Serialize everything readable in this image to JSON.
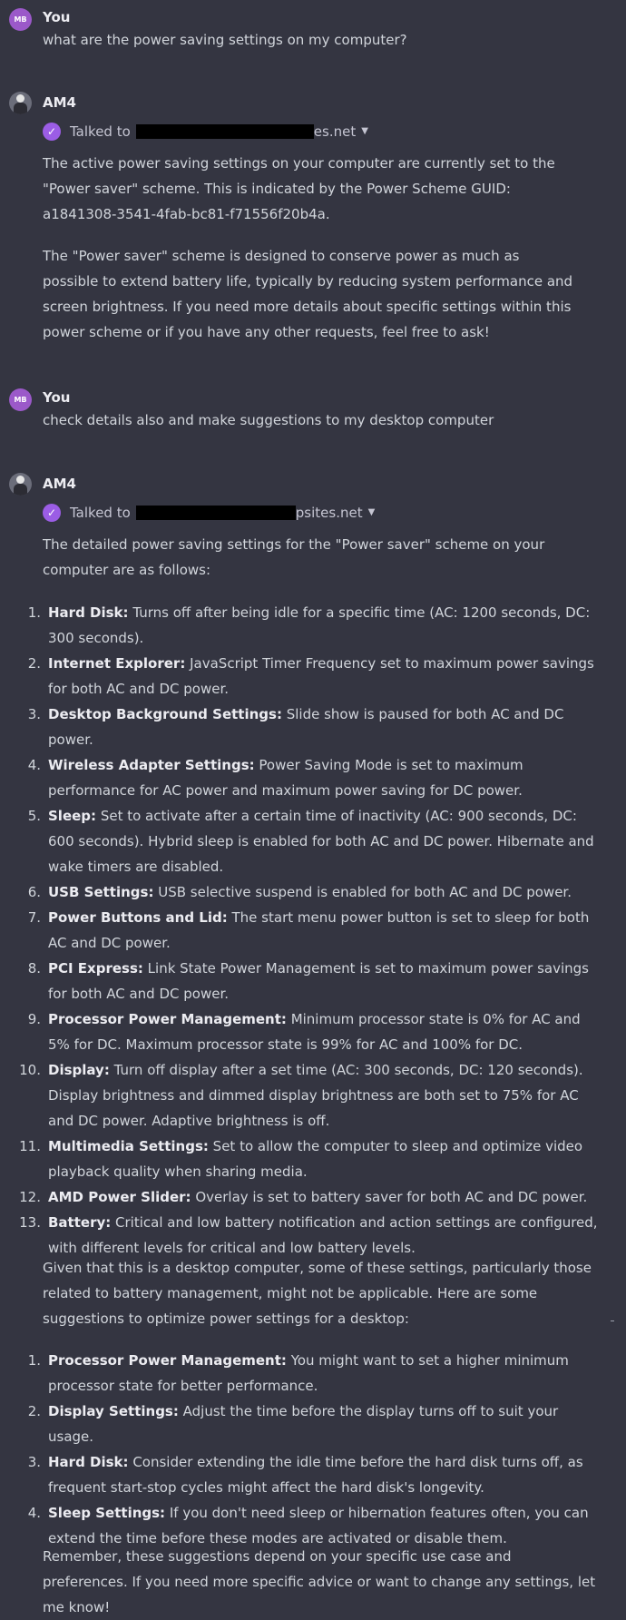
{
  "messages": {
    "m1": {
      "author": "You",
      "avatar_initials": "MB",
      "text": "what are the power saving settings on my computer?"
    },
    "m2": {
      "author": "AM4",
      "tool": {
        "prefix": "Talked to",
        "suffix": "es.net"
      },
      "p1": "The active power saving settings on your computer are currently set to the \"Power saver\" scheme. This is indicated by the Power Scheme GUID: a1841308-3541-4fab-bc81-f71556f20b4a.",
      "p2": "The \"Power saver\" scheme is designed to conserve power as much as possible to extend battery life, typically by reducing system performance and screen brightness. If you need more details about specific settings within this power scheme or if you have any other requests, feel free to ask!"
    },
    "m3": {
      "author": "You",
      "avatar_initials": "MB",
      "text": "check details also and make suggestions to my desktop computer"
    },
    "m4": {
      "author": "AM4",
      "tool": {
        "prefix": "Talked to",
        "suffix": "psites.net"
      },
      "intro": "The detailed power saving settings for the \"Power saver\" scheme on your computer are as follows:",
      "items": [
        {
          "n": "1.",
          "title": "Hard Disk:",
          "text": "Turns off after being idle for a specific time (AC: 1200 seconds, DC: 300 seconds)."
        },
        {
          "n": "2.",
          "title": "Internet Explorer:",
          "text": "JavaScript Timer Frequency set to maximum power savings for both AC and DC power."
        },
        {
          "n": "3.",
          "title": "Desktop Background Settings:",
          "text": "Slide show is paused for both AC and DC power."
        },
        {
          "n": "4.",
          "title": "Wireless Adapter Settings:",
          "text": "Power Saving Mode is set to maximum performance for AC power and maximum power saving for DC power."
        },
        {
          "n": "5.",
          "title": "Sleep:",
          "text": "Set to activate after a certain time of inactivity (AC: 900 seconds, DC: 600 seconds). Hybrid sleep is enabled for both AC and DC power. Hibernate and wake timers are disabled."
        },
        {
          "n": "6.",
          "title": "USB Settings:",
          "text": "USB selective suspend is enabled for both AC and DC power."
        },
        {
          "n": "7.",
          "title": "Power Buttons and Lid:",
          "text": "The start menu power button is set to sleep for both AC and DC power."
        },
        {
          "n": "8.",
          "title": "PCI Express:",
          "text": "Link State Power Management is set to maximum power savings for both AC and DC power."
        },
        {
          "n": "9.",
          "title": "Processor Power Management:",
          "text": "Minimum processor state is 0% for AC and 5% for DC. Maximum processor state is 99% for AC and 100% for DC."
        },
        {
          "n": "10.",
          "title": "Display:",
          "text": "Turn off display after a set time (AC: 300 seconds, DC: 120 seconds). Display brightness and dimmed display brightness are both set to 75% for AC and DC power. Adaptive brightness is off."
        },
        {
          "n": "11.",
          "title": "Multimedia Settings:",
          "text": "Set to allow the computer to sleep and optimize video playback quality when sharing media."
        },
        {
          "n": "12.",
          "title": "AMD Power Slider:",
          "text": "Overlay is set to battery saver for both AC and DC power."
        },
        {
          "n": "13.",
          "title": "Battery:",
          "text": "Critical and low battery notification and action settings are configured, with different levels for critical and low battery levels."
        }
      ],
      "middle": "Given that this is a desktop computer, some of these settings, particularly those related to battery management, might not be applicable. Here are some suggestions to optimize power settings for a desktop:",
      "suggestions": [
        {
          "n": "1.",
          "title": "Processor Power Management:",
          "text": "You might want to set a higher minimum processor state for better performance."
        },
        {
          "n": "2.",
          "title": "Display Settings:",
          "text": "Adjust the time before the display turns off to suit your usage."
        },
        {
          "n": "3.",
          "title": "Hard Disk:",
          "text": "Consider extending the idle time before the hard disk turns off, as frequent start-stop cycles might affect the hard disk's longevity."
        },
        {
          "n": "4.",
          "title": "Sleep Settings:",
          "text": "If you don't need sleep or hibernation features often, you can extend the time before these modes are activated or disable them."
        }
      ],
      "outro": "Remember, these suggestions depend on your specific use case and preferences. If you need more specific advice or want to change any settings, let me know!"
    }
  },
  "colors": {
    "background": "#343541",
    "user_avatar": "#9b59c9",
    "check_badge": "#9b5de5"
  }
}
